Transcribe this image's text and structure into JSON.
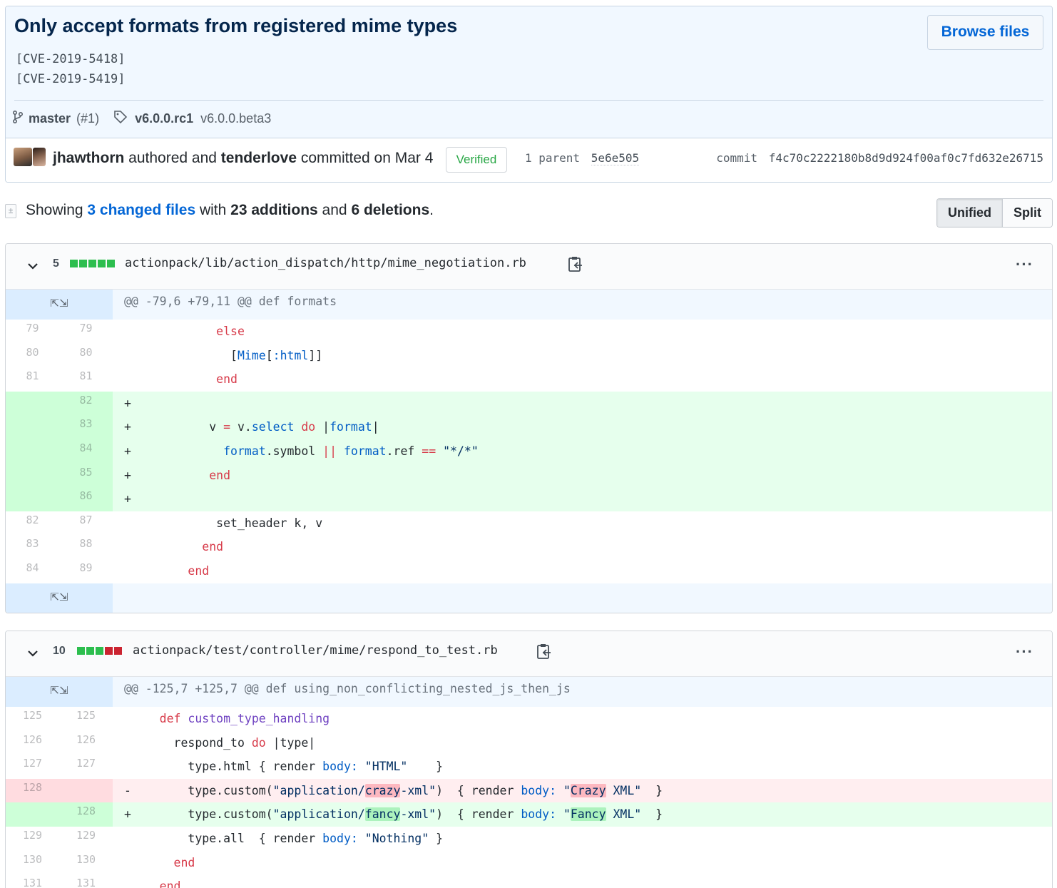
{
  "commit": {
    "title": "Only accept formats from registered mime types",
    "description": "[CVE-2019-5418]\n[CVE-2019-5419]",
    "browse_label": "Browse files",
    "branch": "master",
    "branch_pr": "(#1)",
    "tag_primary": "v6.0.0.rc1",
    "tag_secondary": "v6.0.0.beta3",
    "author": "jhawthorn",
    "authored_text": "authored and",
    "committer": "tenderlove",
    "committed_text": "committed on Mar 4",
    "verified_label": "Verified",
    "parent_label": "1 parent",
    "parent_sha": "5e6e505",
    "commit_label": "commit",
    "commit_sha": "f4c70c2222180b8d9d924f00af0c7fd632e26715"
  },
  "toolbar": {
    "showing": "Showing",
    "changed_files": "3 changed files",
    "with": "with",
    "additions": "23 additions",
    "and": "and",
    "deletions": "6 deletions",
    "period": ".",
    "unified": "Unified",
    "split": "Split"
  },
  "files": [
    {
      "count": "5",
      "path": "actionpack/lib/action_dispatch/http/mime_negotiation.rb",
      "hunk": "@@ -79,6 +79,11 @@ def formats",
      "lines": [
        {
          "old": "79",
          "new": "79"
        },
        {
          "old": "80",
          "new": "80"
        },
        {
          "old": "81",
          "new": "81"
        },
        {
          "old": "",
          "new": "82"
        },
        {
          "old": "",
          "new": "83"
        },
        {
          "old": "",
          "new": "84"
        },
        {
          "old": "",
          "new": "85"
        },
        {
          "old": "",
          "new": "86"
        },
        {
          "old": "82",
          "new": "87"
        },
        {
          "old": "83",
          "new": "88"
        },
        {
          "old": "84",
          "new": "89"
        }
      ]
    },
    {
      "count": "10",
      "path": "actionpack/test/controller/mime/respond_to_test.rb",
      "hunk": "@@ -125,7 +125,7 @@ def using_non_conflicting_nested_js_then_js",
      "lines": [
        {
          "old": "125",
          "new": "125"
        },
        {
          "old": "126",
          "new": "126"
        },
        {
          "old": "127",
          "new": "127"
        },
        {
          "old": "128",
          "new": ""
        },
        {
          "old": "",
          "new": "128"
        },
        {
          "old": "129",
          "new": "129"
        },
        {
          "old": "130",
          "new": "130"
        },
        {
          "old": "131",
          "new": "131"
        }
      ]
    }
  ],
  "colors": {
    "link": "#0366d6",
    "verified": "#28a745",
    "addition_bg": "#e6ffed",
    "deletion_bg": "#ffeef0",
    "hunk_bg": "#f1f8ff"
  }
}
